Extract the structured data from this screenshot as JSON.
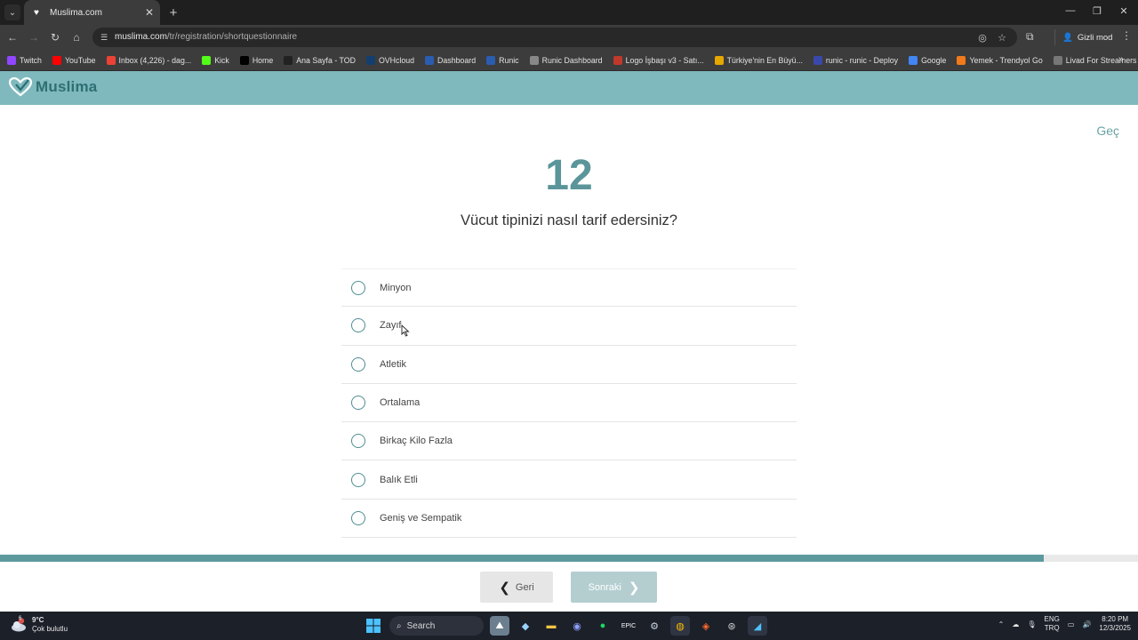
{
  "browser": {
    "tab_title": "Muslima.com",
    "url_host": "muslima.com",
    "url_path": "/tr/registration/shortquestionnaire",
    "incognito_label": "Gizli mod",
    "bookmarks": [
      {
        "label": "Twitch",
        "icon": "twitch-icon",
        "color": "#9146ff"
      },
      {
        "label": "YouTube",
        "icon": "youtube-icon",
        "color": "#ff0000"
      },
      {
        "label": "Inbox (4,226) - dag...",
        "icon": "gmail-icon",
        "color": "#ea4335"
      },
      {
        "label": "Kick",
        "icon": "kick-icon",
        "color": "#53fc18"
      },
      {
        "label": "Home",
        "icon": "x-icon",
        "color": "#000000"
      },
      {
        "label": "Ana Sayfa - TOD",
        "icon": "tod-icon",
        "color": "#222222"
      },
      {
        "label": "OVHcloud",
        "icon": "ovhcloud-icon",
        "color": "#123f6d"
      },
      {
        "label": "Dashboard",
        "icon": "runic-icon",
        "color": "#2a5db0"
      },
      {
        "label": "Runic",
        "icon": "runic-icon",
        "color": "#2a5db0"
      },
      {
        "label": "Runic Dashboard",
        "icon": "runic-star-icon",
        "color": "#888888"
      },
      {
        "label": "Logo İşbaşı v3 - Satı...",
        "icon": "logo-icon",
        "color": "#c0392b"
      },
      {
        "label": "Türkiye'nin En Büyü...",
        "icon": "site-icon",
        "color": "#e6a700"
      },
      {
        "label": "runic - runic - Deploy",
        "icon": "deploy-icon",
        "color": "#3949ab"
      },
      {
        "label": "Google",
        "icon": "google-icon",
        "color": "#4285f4"
      },
      {
        "label": "Yemek - Trendyol Go",
        "icon": "trendyol-icon",
        "color": "#f27a1a"
      },
      {
        "label": "Livad For Streamers",
        "icon": "livad-icon",
        "color": "#777777"
      }
    ]
  },
  "site": {
    "logo_text": "Muslima",
    "skip_label": "Geç",
    "step_number": "12",
    "question": "Vücut tipinizi nasıl tarif edersiniz?",
    "options": [
      "Minyon",
      "Zayıf",
      "Atletik",
      "Ortalama",
      "Birkaç Kilo Fazla",
      "Balık Etli",
      "Geniş ve Sempatik"
    ],
    "progress_percent": 91.7,
    "back_label": "Geri",
    "next_label": "Sonraki",
    "accent_color": "#5c9a9e",
    "header_color": "#7fb9bd"
  },
  "taskbar": {
    "temperature": "9°C",
    "weather_desc": "Çok bulutlu",
    "weather_badge": "6",
    "search_label": "Search",
    "lang_top": "ENG",
    "lang_bottom": "TRQ",
    "time": "8:20 PM",
    "date": "12/3/2025"
  }
}
